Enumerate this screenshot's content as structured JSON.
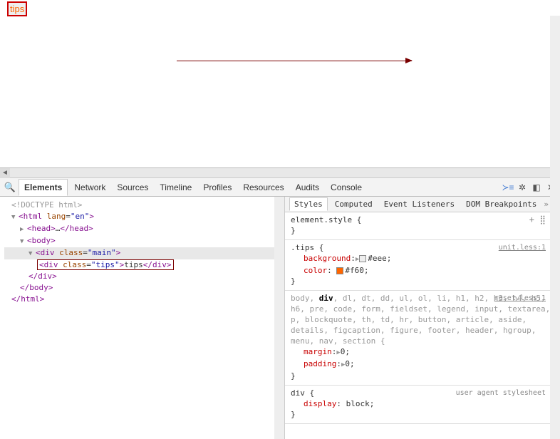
{
  "viewport": {
    "tips_text": "tips"
  },
  "toolbar": {
    "tabs": [
      "Elements",
      "Network",
      "Sources",
      "Timeline",
      "Profiles",
      "Resources",
      "Audits",
      "Console"
    ],
    "active": "Elements"
  },
  "dom": {
    "doctype": "<!DOCTYPE html>",
    "html_open": "<html lang=\"en\">",
    "head": "<head>…</head>",
    "body_open": "<body>",
    "main_open": "<div class=\"main\">",
    "tips_line": "<div class=\"tips\">tips</div>",
    "div_close": "</div>",
    "body_close": "</body>",
    "html_close": "</html>"
  },
  "styles": {
    "tabs": [
      "Styles",
      "Computed",
      "Event Listeners",
      "DOM Breakpoints"
    ],
    "active": "Styles",
    "rules": [
      {
        "selector_html": "element.style {",
        "src": "",
        "props": [],
        "icons": true
      },
      {
        "selector_html": ".tips {",
        "src": "unit.less:1",
        "props": [
          {
            "name": "background",
            "tri": true,
            "swatch": "#eeeeee",
            "value": "#eee;"
          },
          {
            "name": "color",
            "swatch": "#ff6600",
            "value": "#f60;"
          }
        ]
      },
      {
        "selector_html_gray": "body, div, dl, dt, dd, ul, ol, li, h1, h2, h3, h4, h5, h6, pre, code, form, fieldset, legend, input, textarea, p, blockquote, th, td, hr, button, article, aside, details, figcaption, figure, footer, header, hgroup, menu, nav, section {",
        "bold_match": "div",
        "src": "reset.less:1",
        "props": [
          {
            "name": "margin",
            "tri": true,
            "value": "0;"
          },
          {
            "name": "padding",
            "tri": true,
            "value": "0;"
          }
        ]
      },
      {
        "selector_html": "div {",
        "src": "user agent stylesheet",
        "props": [
          {
            "name": "display",
            "value": "block;"
          }
        ]
      }
    ]
  }
}
